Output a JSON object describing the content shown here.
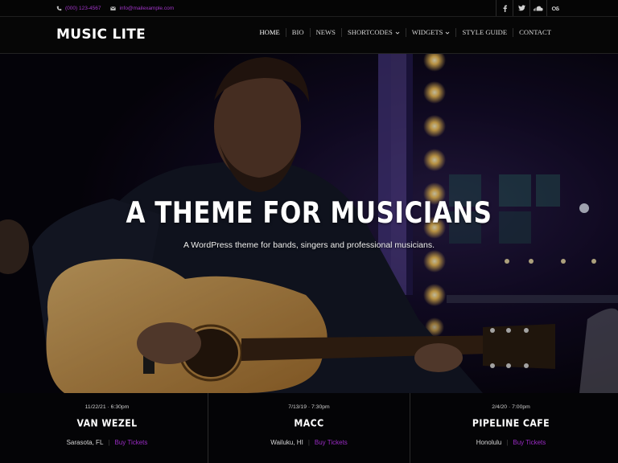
{
  "topbar": {
    "phone": "(000) 123-4567",
    "email": "info@mailexample.com",
    "phone_icon": "phone-icon",
    "email_icon": "envelope-icon",
    "social": [
      {
        "icon": "facebook-icon"
      },
      {
        "icon": "twitter-icon"
      },
      {
        "icon": "soundcloud-icon"
      },
      {
        "icon": "lastfm-icon"
      }
    ]
  },
  "header": {
    "logo": "MUSIC LITE",
    "nav": [
      {
        "label": "HOME",
        "dropdown": false
      },
      {
        "label": "BIO",
        "dropdown": false
      },
      {
        "label": "NEWS",
        "dropdown": false
      },
      {
        "label": "SHORTCODES",
        "dropdown": true
      },
      {
        "label": "WIDGETS",
        "dropdown": true
      },
      {
        "label": "STYLE GUIDE",
        "dropdown": false
      },
      {
        "label": "CONTACT",
        "dropdown": false
      }
    ]
  },
  "hero": {
    "title": "A THEME FOR MUSICIANS",
    "subtitle": "A WordPress theme for bands, singers and professional musicians."
  },
  "events": [
    {
      "date": "11/22/21 · 6:30pm",
      "venue": "VAN WEZEL",
      "city": "Sarasota, FL",
      "tickets": "Buy Tickets"
    },
    {
      "date": "7/13/19 · 7:30pm",
      "venue": "MACC",
      "city": "Wailuku, HI",
      "tickets": "Buy Tickets"
    },
    {
      "date": "2/4/20 · 7:00pm",
      "venue": "PIPELINE CAFE",
      "city": "Honolulu",
      "tickets": "Buy Tickets"
    }
  ],
  "colors": {
    "accent": "#9a2bc4",
    "background": "#000000",
    "text": "#ffffff"
  }
}
